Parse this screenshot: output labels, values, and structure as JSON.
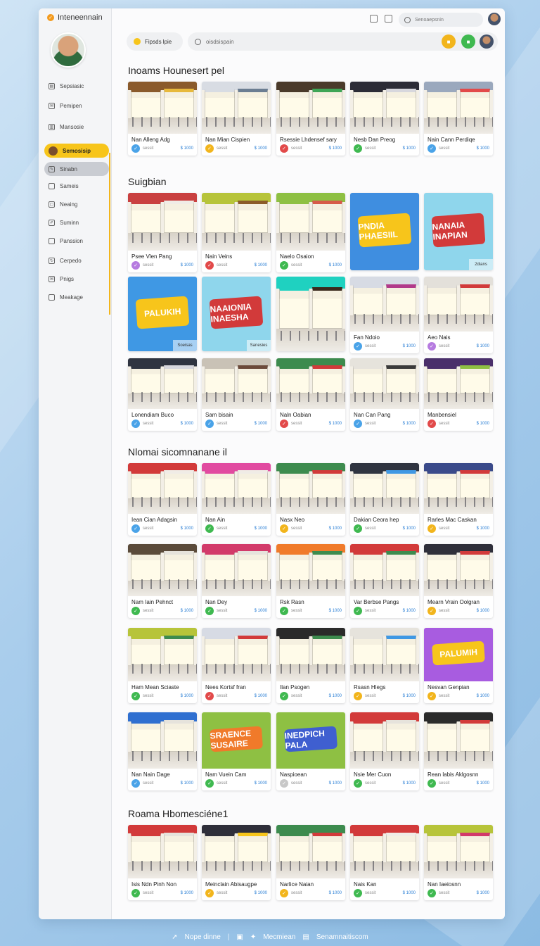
{
  "app": {
    "brand": "Inteneennain"
  },
  "sidebar": {
    "items": [
      {
        "label": "Sepsiasic",
        "icon": "page-icon",
        "state": ""
      },
      {
        "label": "Pemipen",
        "icon": "mail-icon",
        "state": ""
      },
      {
        "label": "Mansosie",
        "icon": "book-icon",
        "state": ""
      },
      {
        "label": "Semosisip",
        "icon": "user-icon",
        "state": "active"
      },
      {
        "label": "Sinabn",
        "icon": "edit-icon",
        "state": "hover"
      },
      {
        "label": "Sameis",
        "icon": "square-icon",
        "state": ""
      },
      {
        "label": "Neaing",
        "icon": "folder-icon",
        "state": ""
      },
      {
        "label": "Suminn",
        "icon": "pencil-icon",
        "state": ""
      },
      {
        "label": "Panssion",
        "icon": "square-icon",
        "state": ""
      },
      {
        "label": "Cerpedo",
        "icon": "refresh-icon",
        "state": ""
      },
      {
        "label": "Pnigs",
        "icon": "mail-icon",
        "state": ""
      },
      {
        "label": "Meakage",
        "icon": "square-icon",
        "state": ""
      }
    ]
  },
  "topbar": {
    "search_placeholder": "Senoaepsnin"
  },
  "subbar": {
    "pill_label": "Fipsds lpie",
    "search_placeholder": "oisdsispain"
  },
  "colors": {
    "accent": "#f7c51b",
    "green": "#3fb950",
    "yellow": "#f2b51c",
    "red": "#e24a4a",
    "blue": "#4aa3e8",
    "purple": "#b67be0",
    "gray": "#c8c8c8"
  },
  "sections": [
    {
      "title": "Inoams Hounesert pel",
      "cards": [
        {
          "title": "Nan Alleng Adg",
          "badge": "blue",
          "meta": "sessit",
          "price": "$ 1000",
          "scene": "store",
          "palette": [
            "#8a5a2b",
            "#e7b93c"
          ]
        },
        {
          "title": "Nan Mian Cispien",
          "badge": "yellow",
          "meta": "sessit",
          "price": "$ 1000",
          "scene": "store",
          "palette": [
            "#d8dce3",
            "#6b7d92"
          ]
        },
        {
          "title": "Rsessie Lhdensef sary",
          "badge": "red",
          "meta": "sessit",
          "price": "$ 1000",
          "scene": "store",
          "palette": [
            "#4a3a2a",
            "#3fa556"
          ]
        },
        {
          "title": "Nesb Dan Preog",
          "badge": "green",
          "meta": "sessit",
          "price": "$ 1000",
          "scene": "store",
          "palette": [
            "#2c2c36",
            "#d7d7dd"
          ]
        },
        {
          "title": "Nain Cann Perdiqe",
          "badge": "blue",
          "meta": "sessit",
          "price": "$ 1000",
          "scene": "store",
          "palette": [
            "#9aa8bd",
            "#e24a4a"
          ]
        }
      ]
    },
    {
      "title": "Suigbian",
      "cards": [
        {
          "title": "Psee Vlen Pang",
          "badge": "purple",
          "meta": "sessit",
          "price": "$ 1000",
          "scene": "store",
          "palette": [
            "#c94040",
            "#f0ece6"
          ]
        },
        {
          "title": "Nain Veins",
          "badge": "red",
          "meta": "sessit",
          "price": "$ 1000",
          "scene": "store",
          "palette": [
            "#b7c43a",
            "#8b5b2a"
          ]
        },
        {
          "title": "Naelo Osaion",
          "badge": "green",
          "meta": "sessit",
          "price": "$ 1000",
          "scene": "store",
          "palette": [
            "#8ec043",
            "#d65b4a"
          ]
        },
        {
          "title": "",
          "badge": "",
          "meta": "",
          "price": "",
          "scene": "logo",
          "logo": "PNDIA PHAESIIL",
          "palette": [
            "#3f8ee0",
            "#f7c51b"
          ]
        },
        {
          "title": "",
          "badge": "",
          "meta": "",
          "price": "",
          "scene": "logo",
          "logo": "NANAIA INAPIAN",
          "palette": [
            "#8fd6ec",
            "#d23a3a"
          ],
          "tag": "2dians"
        },
        {
          "title": "",
          "badge": "",
          "meta": "",
          "price": "",
          "scene": "logo",
          "logo": "PALUKIH",
          "palette": [
            "#3f98e4",
            "#f7c51b"
          ],
          "tag": "Soeisas"
        },
        {
          "title": "",
          "badge": "",
          "meta": "",
          "price": "",
          "scene": "logo",
          "logo": "NAAIONIA INAESHA",
          "palette": [
            "#8fd6ec",
            "#d23a3a"
          ],
          "tag": "Sanesies"
        },
        {
          "title": "",
          "badge": "",
          "meta": "",
          "price": "",
          "scene": "store",
          "palette": [
            "#1fd1c0",
            "#3a2a1e"
          ]
        },
        {
          "title": "Fan Ndoio",
          "badge": "blue",
          "meta": "sessit",
          "price": "$ 1000",
          "scene": "store",
          "palette": [
            "#d7dbe4",
            "#b23a8a"
          ]
        },
        {
          "title": "Aeo Nais",
          "badge": "purple",
          "meta": "sessit",
          "price": "$ 1000",
          "scene": "store",
          "palette": [
            "#e3e0da",
            "#d23a3a"
          ]
        },
        {
          "title": "Lonendiam Buco",
          "badge": "blue",
          "meta": "sessit",
          "price": "$ 1000",
          "scene": "store",
          "palette": [
            "#2f3440",
            "#d7d7dd"
          ]
        },
        {
          "title": "Sam bisain",
          "badge": "blue",
          "meta": "sessit",
          "price": "$ 1000",
          "scene": "store",
          "palette": [
            "#c9c2b6",
            "#6b4a3a"
          ]
        },
        {
          "title": "Naln Oabian",
          "badge": "red",
          "meta": "sessit",
          "price": "$ 1000",
          "scene": "store",
          "palette": [
            "#3d8b4e",
            "#d23a3a"
          ]
        },
        {
          "title": "Nan Can Pang",
          "badge": "blue",
          "meta": "sessit",
          "price": "$ 1000",
          "scene": "store",
          "palette": [
            "#e6e3dc",
            "#3a3a3a"
          ]
        },
        {
          "title": "Manbensiel",
          "badge": "red",
          "meta": "sessit",
          "price": "$ 1000",
          "scene": "store",
          "palette": [
            "#4a2f6b",
            "#8ec043"
          ]
        }
      ]
    },
    {
      "title": "Nlomai sicomnanane il",
      "cards": [
        {
          "title": "Iean Cian Adagsin",
          "badge": "blue",
          "meta": "sessit",
          "price": "$ 1000",
          "scene": "store",
          "palette": [
            "#d23a3a",
            "#f0ece6"
          ]
        },
        {
          "title": "Nan Ain",
          "badge": "green",
          "meta": "sessit",
          "price": "$ 1000",
          "scene": "store",
          "palette": [
            "#e14aa0",
            "#f0ece6"
          ]
        },
        {
          "title": "Nasx Neo",
          "badge": "yellow",
          "meta": "sessit",
          "price": "$ 1000",
          "scene": "store",
          "palette": [
            "#3d8b4e",
            "#d23a3a"
          ]
        },
        {
          "title": "Dakian Ceora hep",
          "badge": "green",
          "meta": "sessit",
          "price": "$ 1000",
          "scene": "store",
          "palette": [
            "#2f3440",
            "#3f98e4"
          ]
        },
        {
          "title": "Rarles Mac Caskan",
          "badge": "yellow",
          "meta": "sessit",
          "price": "$ 1000",
          "scene": "store",
          "palette": [
            "#3a4a8a",
            "#d23a3a"
          ]
        },
        {
          "title": "Nam Iain Pehnct",
          "badge": "green",
          "meta": "sessit",
          "price": "$ 1000",
          "scene": "store",
          "palette": [
            "#5a4a3a",
            "#e6e3dc"
          ]
        },
        {
          "title": "Nan Dey",
          "badge": "green",
          "meta": "sessit",
          "price": "$ 1000",
          "scene": "store",
          "palette": [
            "#d23a6a",
            "#e6e3dc"
          ]
        },
        {
          "title": "Rsk Rasn",
          "badge": "green",
          "meta": "sessit",
          "price": "$ 1000",
          "scene": "store",
          "palette": [
            "#f07a2a",
            "#3d8b4e"
          ]
        },
        {
          "title": "Var Berbse Pangs",
          "badge": "green",
          "meta": "sessit",
          "price": "$ 1000",
          "scene": "store",
          "palette": [
            "#d23a3a",
            "#3d8b4e"
          ]
        },
        {
          "title": "Mearn Vrain Oolgran",
          "badge": "yellow",
          "meta": "sessit",
          "price": "$ 1000",
          "scene": "store",
          "palette": [
            "#2f2f3a",
            "#d23a3a"
          ]
        },
        {
          "title": "Ham Mean Sciaste",
          "badge": "green",
          "meta": "sessit",
          "price": "$ 1000",
          "scene": "store",
          "palette": [
            "#b7c43a",
            "#3d8b4e"
          ]
        },
        {
          "title": "Nees Kortsf fran",
          "badge": "red",
          "meta": "sessit",
          "price": "$ 1000",
          "scene": "store",
          "palette": [
            "#d7dbe4",
            "#d23a3a"
          ]
        },
        {
          "title": "Ilan Psogen",
          "badge": "green",
          "meta": "sessit",
          "price": "$ 1000",
          "scene": "store",
          "palette": [
            "#2a2a2a",
            "#3d8b4e"
          ]
        },
        {
          "title": "Rsasn Hlegs",
          "badge": "yellow",
          "meta": "sessit",
          "price": "$ 1000",
          "scene": "store",
          "palette": [
            "#e6e3dc",
            "#3f98e4"
          ]
        },
        {
          "title": "Nesvan Genpian",
          "badge": "yellow",
          "meta": "sessit",
          "price": "$ 1000",
          "scene": "logo",
          "logo": "PALUMIH",
          "palette": [
            "#a85ce0",
            "#f7c51b"
          ]
        },
        {
          "title": "Nan Nain Dage",
          "badge": "blue",
          "meta": "sessit",
          "price": "$ 1000",
          "scene": "store",
          "palette": [
            "#2f6fd0",
            "#e6e3dc"
          ]
        },
        {
          "title": "Nam Vuein Cam",
          "badge": "green",
          "meta": "sessit",
          "price": "$ 1000",
          "scene": "logo",
          "logo": "SRAENCE SUSAIRE",
          "palette": [
            "#8ec043",
            "#f07a2a"
          ]
        },
        {
          "title": "Naspioean",
          "badge": "gray",
          "meta": "sessit",
          "price": "$ 1000",
          "scene": "logo",
          "logo": "INEDPICH PALA",
          "palette": [
            "#8ec043",
            "#3f5fd0"
          ]
        },
        {
          "title": "Nsie Mer Cuon",
          "badge": "green",
          "meta": "sessit",
          "price": "$ 1000",
          "scene": "store",
          "palette": [
            "#d23a3a",
            "#e6e3dc"
          ]
        },
        {
          "title": "Rean labis Aklgosnn",
          "badge": "green",
          "meta": "sessit",
          "price": "$ 1000",
          "scene": "store",
          "palette": [
            "#2a2a2a",
            "#d23a3a"
          ]
        }
      ]
    },
    {
      "title": "Roama Hbomesciéne1",
      "cards": [
        {
          "title": "Isis Ndn Pinh Non",
          "badge": "green",
          "meta": "sessit",
          "price": "$ 1000",
          "scene": "store",
          "palette": [
            "#d23a3a",
            "#e6e3dc"
          ]
        },
        {
          "title": "Meinclain Abisaugpe",
          "badge": "yellow",
          "meta": "sessit",
          "price": "$ 1000",
          "scene": "store",
          "palette": [
            "#2f2f3a",
            "#f7c51b"
          ]
        },
        {
          "title": "Narlice Naian",
          "badge": "yellow",
          "meta": "sessit",
          "price": "$ 1000",
          "scene": "store",
          "palette": [
            "#3d8b4e",
            "#d23a3a"
          ]
        },
        {
          "title": "Nais Kan",
          "badge": "green",
          "meta": "sessit",
          "price": "$ 1000",
          "scene": "store",
          "palette": [
            "#d23a3a",
            "#f0ece6"
          ]
        },
        {
          "title": "Nan Iaeiosnn",
          "badge": "green",
          "meta": "sessit",
          "price": "$ 1000",
          "scene": "store",
          "palette": [
            "#b7c43a",
            "#d23a6a"
          ]
        }
      ]
    }
  ],
  "footer": {
    "left": "Nope dinne",
    "sep": "|",
    "middle": "Mecmiean",
    "right": "Senamnaitiscom"
  }
}
